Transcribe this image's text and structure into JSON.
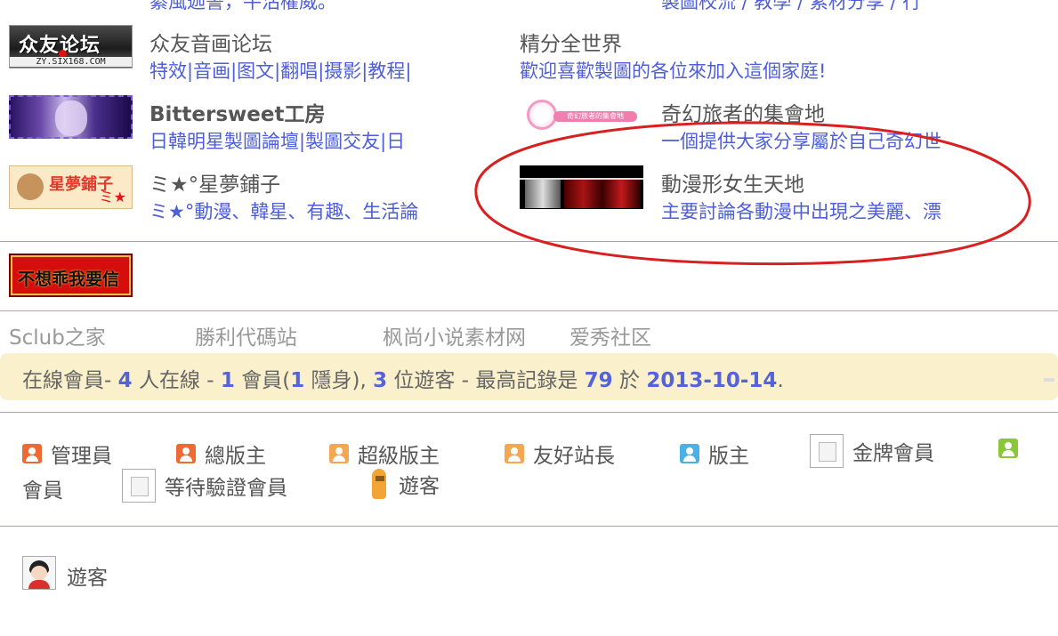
{
  "top_partial": {
    "left": "綦風迦誓，牛沽權威。",
    "right": "製圖校流 / 教學 / 素材分享 / 行"
  },
  "forums": [
    {
      "banner_text": "众友论坛",
      "banner_sub": "ZY.SIX168.COM",
      "name": "众友音画论坛",
      "desc": "特效|音画|图文|翻唱|摄影|教程|"
    },
    {
      "name": "精分全世界",
      "desc": "歡迎喜歡製圖的各位來加入這個家庭!"
    },
    {
      "name": "Bittersweet工房",
      "desc": "日韓明星製圖論壇|製圖交友|日"
    },
    {
      "banner_text": "奇幻旅者的集會地",
      "name": "奇幻旅者的集會地",
      "desc": "一個提供大家分享屬於自己奇幻世"
    },
    {
      "banner_text": "星夢鋪子",
      "name": "ミ★°星夢鋪子",
      "desc": "ミ★°動漫、韓星、有趣、生活論"
    },
    {
      "name": "動漫形女生天地",
      "desc": "主要討論各動漫中出現之美麗、漂"
    }
  ],
  "red_banner": {
    "text": "不想乖我要信"
  },
  "text_links": [
    "Sclub之家",
    "勝利代碼站",
    "枫尚小说素材网",
    "爱秀社区"
  ],
  "online": {
    "label": "在線會員",
    "sep1": "- ",
    "count": "4",
    "count_unit": " 人在線 - ",
    "members": "1",
    "members_unit": " 會員(",
    "hidden": "1",
    "hidden_unit": " 隱身), ",
    "guests": "3",
    "guests_unit": " 位遊客 - 最高記錄是 ",
    "record": "79",
    "at": " 於 ",
    "record_date": "2013-10-14",
    "end": "."
  },
  "legend": [
    {
      "label": "管理員",
      "icon": "admin-icon"
    },
    {
      "label": "總版主",
      "icon": "super-moderator-icon"
    },
    {
      "label": "超級版主",
      "icon": "super-moderator-icon"
    },
    {
      "label": "友好站長",
      "icon": "friend-admin-icon"
    },
    {
      "label": "版主",
      "icon": "moderator-icon"
    },
    {
      "label": "金牌會員",
      "icon": "broken-image-icon"
    },
    {
      "label": "會員",
      "icon": "member-icon"
    },
    {
      "label": "等待驗證會員",
      "icon": "broken-image-icon"
    },
    {
      "label": "遊客",
      "icon": "alpaca-icon"
    }
  ],
  "guest_list": [
    {
      "label": "遊客",
      "icon": "guest-avatar-icon"
    }
  ],
  "colors": {
    "link_blue": "#4d5ed6",
    "divider": "#e07fd0",
    "online_bg": "#fbf0cc",
    "annotation_red": "#d92020"
  }
}
